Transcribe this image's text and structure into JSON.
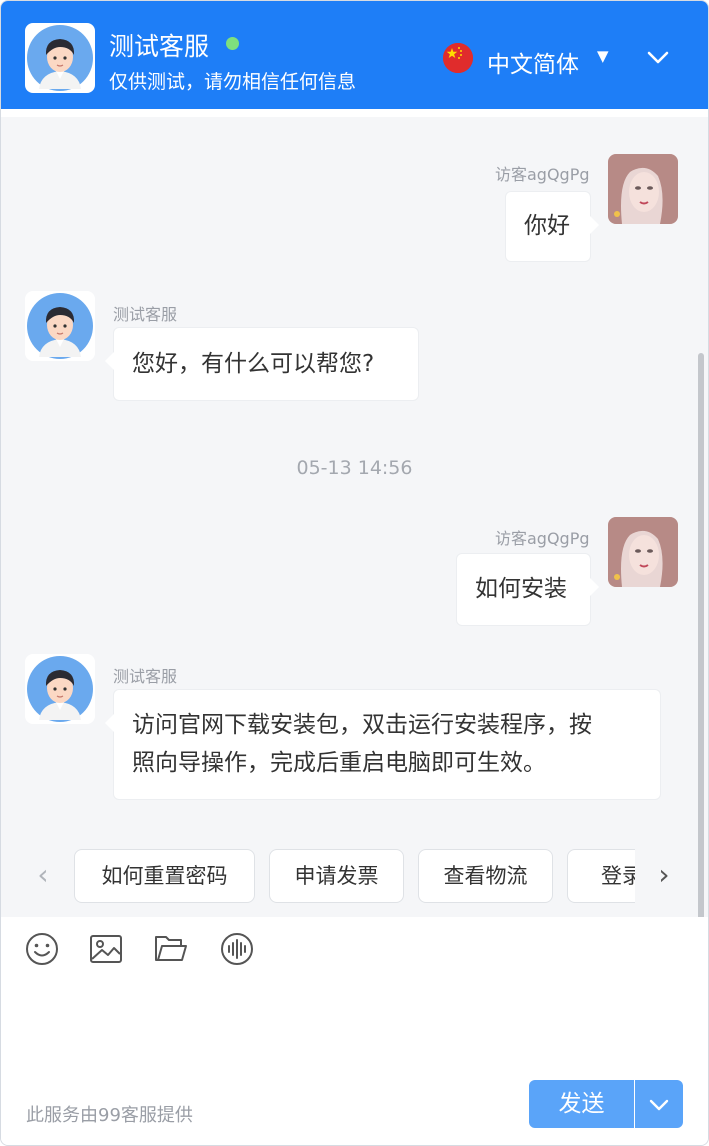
{
  "header": {
    "agent_name": "测试客服",
    "subtitle": "仅供测试，请勿相信任何信息",
    "language": "中文简体",
    "status_color": "#7ee07e",
    "accent_color": "#1e7ef7"
  },
  "messages": [
    {
      "side": "right",
      "sender": "访客agQgPg",
      "text": "你好"
    },
    {
      "side": "left",
      "sender": "测试客服",
      "text": "您好，有什么可以帮您?"
    },
    {
      "timestamp": "05-13 14:56"
    },
    {
      "side": "right",
      "sender": "访客agQgPg",
      "text": "如何安装"
    },
    {
      "side": "left",
      "sender": "测试客服",
      "text_lines": [
        "访问官网下载安装包，双击运行安装程序，按",
        "照向导操作，完成后重启电脑即可生效。"
      ]
    }
  ],
  "quick_replies": [
    "如何重置密码",
    "申请发票",
    "查看物流",
    "登录"
  ],
  "composer": {
    "tools": [
      "emoji-icon",
      "image-icon",
      "folder-icon",
      "voice-icon"
    ],
    "placeholder": "",
    "provider_text": "此服务由99客服提供",
    "send_label": "发送"
  }
}
